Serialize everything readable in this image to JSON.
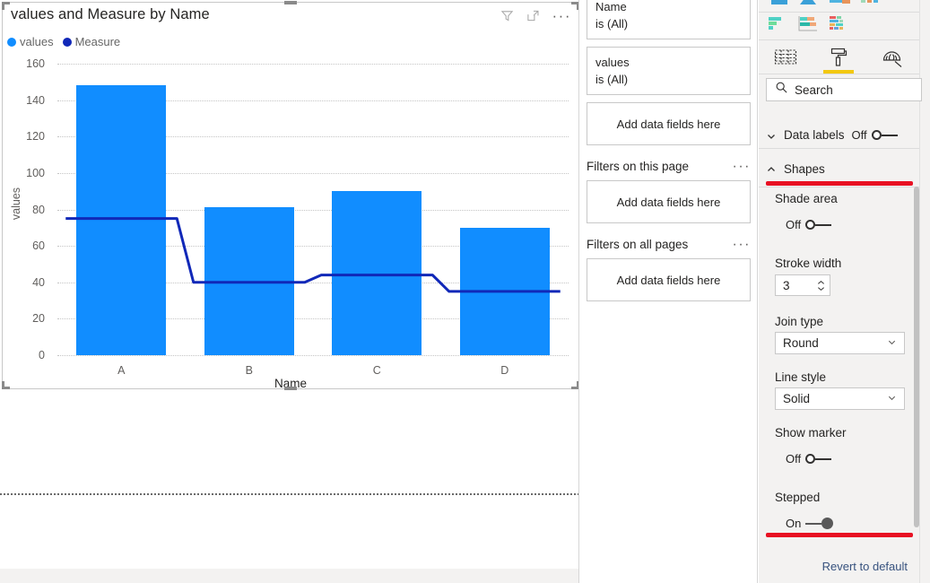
{
  "visual": {
    "title": "values and Measure by Name",
    "icons": [
      "filter-icon",
      "focus-mode-icon",
      "more-options-icon"
    ],
    "more_options_label": "···",
    "legend": [
      {
        "label": "values",
        "color": "#118DFF"
      },
      {
        "label": "Measure",
        "color": "#1128B8"
      }
    ]
  },
  "chart_data": {
    "type": "bar",
    "title": "values and Measure by Name",
    "categories": [
      "A",
      "B",
      "C",
      "D"
    ],
    "xlabel": "Name",
    "ylabel": "values",
    "ylim": [
      0,
      160
    ],
    "yticks": [
      0,
      20,
      40,
      60,
      80,
      100,
      120,
      140,
      160
    ],
    "grid": true,
    "legend_position": "top-left",
    "series": [
      {
        "name": "values",
        "type": "column",
        "color": "#118DFF",
        "values": [
          148,
          81,
          90,
          70
        ]
      },
      {
        "name": "Measure",
        "type": "stepped-line",
        "color": "#1128B8",
        "values": [
          75,
          40,
          44,
          35
        ]
      }
    ]
  },
  "filters": {
    "cards": [
      {
        "name": "Name",
        "condition": "is (All)"
      },
      {
        "name": "values",
        "condition": "is (All)"
      }
    ],
    "visual_drop_label": "Add data fields here",
    "sections": [
      {
        "title": "Filters on this page",
        "dots": "···",
        "drop_label": "Add data fields here"
      },
      {
        "title": "Filters on all pages",
        "dots": "···",
        "drop_label": "Add data fields here"
      }
    ]
  },
  "panel": {
    "viz_icons": [
      "stacked-bar-chart-icon",
      "clustered-bar-chart-icon",
      "hundred-percent-stacked-bar-chart-icon"
    ],
    "tabs": [
      {
        "name": "fields-tab",
        "icon": "fields-table-icon",
        "selected": false
      },
      {
        "name": "format-tab",
        "icon": "paint-roller-icon",
        "selected": true
      },
      {
        "name": "analytics-tab",
        "icon": "magnifier-chart-icon",
        "selected": false
      }
    ],
    "search": {
      "placeholder": "Search",
      "value": "",
      "icon": "search-icon"
    },
    "sections": [
      {
        "title": "Data labels",
        "expanded": false,
        "chevron": "chevron-down-icon",
        "toggle_state": "Off"
      },
      {
        "title": "Shapes",
        "expanded": true,
        "chevron": "chevron-up-icon"
      }
    ],
    "shapes": {
      "shade_area": {
        "label": "Shade area",
        "state": "Off"
      },
      "stroke_width": {
        "label": "Stroke width",
        "value": "3"
      },
      "join_type": {
        "label": "Join type",
        "value": "Round"
      },
      "line_style": {
        "label": "Line style",
        "value": "Solid"
      },
      "show_marker": {
        "label": "Show marker",
        "state": "Off"
      },
      "stepped": {
        "label": "Stepped",
        "state": "On"
      }
    },
    "revert_label": "Revert to default",
    "accent_color": "#F2C811",
    "annotation_color": "#E81123"
  }
}
